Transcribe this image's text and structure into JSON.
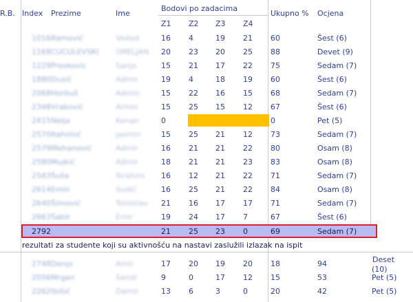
{
  "header": {
    "rb": "R.B.",
    "index": "Index",
    "prezime": "Prezime",
    "ime": "Ime",
    "bodovi": "Bodovi po zadacima",
    "z1": "Z1",
    "z2": "Z2",
    "z3": "Z3",
    "z4": "Z4",
    "ukupno": "Ukupno %",
    "ocjena": "Ocjena"
  },
  "rows": [
    {
      "idx": "1016",
      "prezime": "Ramović",
      "ime": "Vedad",
      "z1": "16",
      "z2": "4",
      "z3": "19",
      "z4": "21",
      "uk": "60",
      "oc": "Šest (6)"
    },
    {
      "idx": "1168",
      "prezime": "CUCULEVSKI",
      "ime": "SMELJAN",
      "z1": "20",
      "z2": "23",
      "z3": "20",
      "z4": "25",
      "uk": "88",
      "oc": "Devet (9)"
    },
    {
      "idx": "1229",
      "prezime": "Preskovic",
      "ime": "Sanjo",
      "z1": "15",
      "z2": "21",
      "z3": "17",
      "z4": "22",
      "uk": "75",
      "oc": "Sedam (7)"
    },
    {
      "idx": "1880",
      "prezime": "Duzić",
      "ime": "Admir",
      "z1": "19",
      "z2": "4",
      "z3": "18",
      "z4": "19",
      "uk": "60",
      "oc": "Šest (6)"
    },
    {
      "idx": "2068",
      "prezime": "Horbuš",
      "ime": "Admin",
      "z1": "15",
      "z2": "22",
      "z3": "16",
      "z4": "15",
      "uk": "68",
      "oc": "Sedam (7)"
    },
    {
      "idx": "2348",
      "prezime": "Vraković",
      "ime": "Armin",
      "z1": "15",
      "z2": "25",
      "z3": "15",
      "z4": "12",
      "uk": "67",
      "oc": "Šest (6)"
    },
    {
      "idx": "2415",
      "prezime": "Nelja",
      "ime": "Kenan",
      "z1": "0",
      "z2": "",
      "z3": "",
      "z4": "",
      "uk": "0",
      "oc": "Pet (5)",
      "missing": true
    },
    {
      "idx": "2570",
      "prezime": "Rahimić",
      "ime": "Jasmin",
      "z1": "15",
      "z2": "25",
      "z3": "21",
      "z4": "12",
      "uk": "73",
      "oc": "Sedam (7)"
    },
    {
      "idx": "2579",
      "prezime": "Mehanović",
      "ime": "Admir",
      "z1": "16",
      "z2": "21",
      "z3": "21",
      "z4": "22",
      "uk": "80",
      "oc": "Osam (8)"
    },
    {
      "idx": "2580",
      "prezime": "Mujkić",
      "ime": "Admir",
      "z1": "18",
      "z2": "21",
      "z3": "21",
      "z4": "23",
      "uk": "83",
      "oc": "Osam (8)"
    },
    {
      "idx": "2583",
      "prezime": "Šuša",
      "ime": "Ibrahim",
      "z1": "16",
      "z2": "12",
      "z3": "21",
      "z4": "22",
      "uk": "71",
      "oc": "Sedam (7)"
    },
    {
      "idx": "2614",
      "prezime": "Emin",
      "ime": "Sudić",
      "z1": "16",
      "z2": "25",
      "z3": "21",
      "z4": "22",
      "uk": "84",
      "oc": "Osam (8)"
    },
    {
      "idx": "2640",
      "prezime": "Šimović",
      "ime": "Tomislav",
      "z1": "21",
      "z2": "16",
      "z3": "17",
      "z4": "17",
      "uk": "71",
      "oc": "Sedam (7)"
    },
    {
      "idx": "2663",
      "prezime": "Šabir",
      "ime": "Emir",
      "z1": "19",
      "z2": "24",
      "z3": "17",
      "z4": "7",
      "uk": "67",
      "oc": "Šest (6)"
    }
  ],
  "highlight": {
    "idx": "2792",
    "z1": "21",
    "z2": "25",
    "z3": "23",
    "z4": "0",
    "uk": "69",
    "oc": "Sedam (7)"
  },
  "note": "rezultati za studente koji su aktivnošću na nastavi zaslužili izlazak na ispit",
  "rows2": [
    {
      "idx": "2748",
      "prezime": "Denjo",
      "ime": "Amir",
      "z1": "17",
      "z2": "20",
      "z3": "19",
      "z4": "20",
      "uk": "18",
      "pct": "94",
      "oc1": "Deset",
      "oc2": "(10)"
    },
    {
      "idx": "2056",
      "prezime": "Mrgan",
      "ime": "Sandi",
      "z1": "9",
      "z2": "0",
      "z3": "17",
      "z4": "12",
      "uk": "15",
      "pct": "53",
      "oc1": "Pet (5)",
      "oc2": ""
    },
    {
      "idx": "2262",
      "prezime": "Ibišić",
      "ime": "Damir",
      "z1": "13",
      "z2": "6",
      "z3": "3",
      "z4": "0",
      "uk": "20",
      "pct": "42",
      "oc1": "Pet (5)",
      "oc2": ""
    }
  ]
}
